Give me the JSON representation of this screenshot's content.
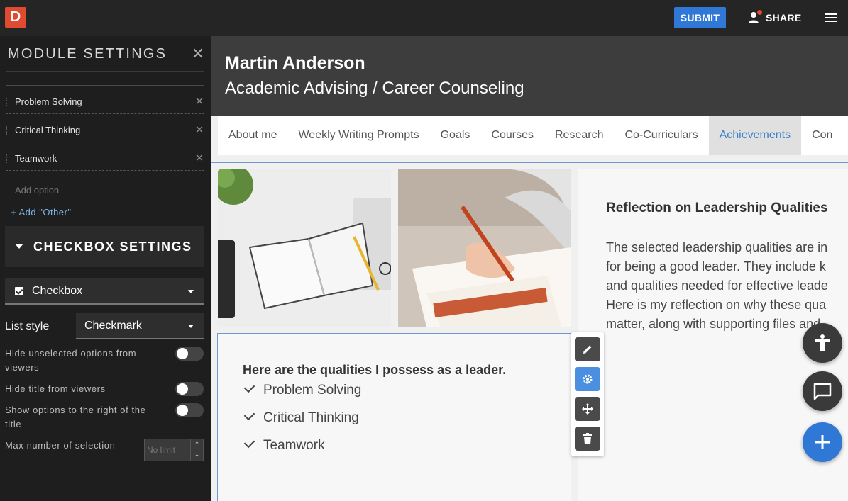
{
  "app": {
    "logo_letter": "D",
    "submit_label": "SUBMIT",
    "share_label": "SHARE"
  },
  "sidebar": {
    "title": "MODULE SETTINGS",
    "options": [
      {
        "label": "Problem Solving"
      },
      {
        "label": "Critical Thinking"
      },
      {
        "label": "Teamwork"
      }
    ],
    "add_option_placeholder": "Add option",
    "add_other_label": "+ Add \"Other\"",
    "section_title": "CHECKBOX SETTINGS",
    "type_select_value": "Checkbox",
    "list_style_label": "List style",
    "list_style_value": "Checkmark",
    "toggles": [
      {
        "label": "Hide unselected options from viewers",
        "on": false
      },
      {
        "label": "Hide title from viewers",
        "on": false
      },
      {
        "label": "Show options to the right of the title",
        "on": false
      }
    ],
    "max_selection_label": "Max number of selection",
    "max_selection_placeholder": "No limit"
  },
  "header": {
    "name": "Martin Anderson",
    "subtitle": "Academic Advising / Career Counseling"
  },
  "tabs": [
    {
      "label": "About me",
      "active": false
    },
    {
      "label": "Weekly Writing Prompts",
      "active": false
    },
    {
      "label": "Goals",
      "active": false
    },
    {
      "label": "Courses",
      "active": false
    },
    {
      "label": "Research",
      "active": false
    },
    {
      "label": "Co-Curriculars",
      "active": false
    },
    {
      "label": "Achievements",
      "active": true
    },
    {
      "label": "Con",
      "active": false
    }
  ],
  "qualities": {
    "title": "Here are the qualities I possess as a leader.",
    "items": [
      "Problem Solving",
      "Critical Thinking",
      "Teamwork"
    ]
  },
  "reflection": {
    "title": "Reflection on Leadership Qualities",
    "lines": [
      "The selected leadership qualities are in",
      "for being a good leader. They include k",
      "and qualities needed for effective leade",
      "Here is my reflection on why these qua",
      "matter, along with supporting files and"
    ]
  },
  "colors": {
    "accent": "#2f78d6",
    "logo": "#e04a30",
    "active_tab": "#3b82c8"
  }
}
